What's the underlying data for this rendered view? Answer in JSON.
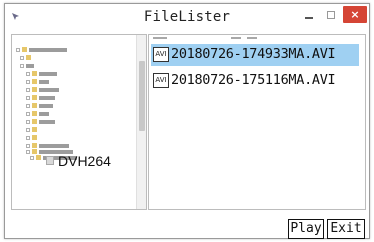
{
  "window": {
    "title": "FileLister",
    "close_glyph": "×",
    "app_icon": "app-icon"
  },
  "tree": {
    "selected_folder": "DVH264"
  },
  "files": [
    {
      "icon_label": "AVI",
      "name": "20180726-174933MA.AVI",
      "selected": true
    },
    {
      "icon_label": "AVI",
      "name": "20180726-175116MA.AVI",
      "selected": false
    }
  ],
  "buttons": {
    "play": "Play",
    "exit": "Exit"
  },
  "colors": {
    "selection": "#9fd0f2",
    "close_button": "#d54535"
  }
}
